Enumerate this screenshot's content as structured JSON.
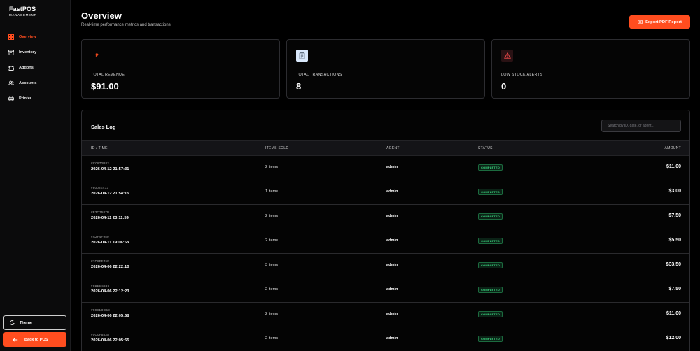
{
  "sidebar": {
    "brand_name": "FastPOS",
    "brand_sub": "MANAGEMENT",
    "items": [
      {
        "label": "Overview",
        "icon": "grid-icon",
        "active": true
      },
      {
        "label": "Inventory",
        "icon": "box-icon",
        "active": false
      },
      {
        "label": "Addons",
        "icon": "puzzle-icon",
        "active": false
      },
      {
        "label": "Accounts",
        "icon": "users-icon",
        "active": false
      },
      {
        "label": "Printer",
        "icon": "printer-icon",
        "active": false
      }
    ],
    "theme_label": "Theme",
    "back_label": "Back to POS"
  },
  "header": {
    "title": "Overview",
    "subtitle": "Real-time performance metrics and transactions.",
    "export_label": "Export PDF Report"
  },
  "stats": [
    {
      "icon_text": "₱",
      "label": "TOTAL REVENUE",
      "value": "$91.00"
    },
    {
      "label": "TOTAL TRANSACTIONS",
      "value": "8"
    },
    {
      "label": "LOW STOCK ALERTS",
      "value": "0"
    }
  ],
  "sales_log": {
    "title": "Sales Log",
    "search_placeholder": "Search by ID, date, or agent...",
    "columns": [
      "ID / TIME",
      "ITEMS SOLD",
      "AGENT",
      "STATUS",
      "AMOUNT"
    ],
    "rows": [
      {
        "id": "#C0870B82",
        "time": "2026-04-12 21:57:31",
        "items": "2 items",
        "agent": "admin",
        "status": "COMPLETED",
        "amount": "$11.00"
      },
      {
        "id": "#8008E413",
        "time": "2026-04-12 21:54:15",
        "items": "1 items",
        "agent": "admin",
        "status": "COMPLETED",
        "amount": "$3.00"
      },
      {
        "id": "#F3C7587B",
        "time": "2026-04-11 23:11:59",
        "items": "2 items",
        "agent": "admin",
        "status": "COMPLETED",
        "amount": "$7.50"
      },
      {
        "id": "#A2F4F950",
        "time": "2026-04-11 19:06:58",
        "items": "2 items",
        "agent": "admin",
        "status": "COMPLETED",
        "amount": "$5.50"
      },
      {
        "id": "#1D8FF45E",
        "time": "2026-04-06 22:22:10",
        "items": "3 items",
        "agent": "admin",
        "status": "COMPLETED",
        "amount": "$33.50"
      },
      {
        "id": "#8BEB4335",
        "time": "2026-04-06 22:12:23",
        "items": "2 items",
        "agent": "admin",
        "status": "COMPLETED",
        "amount": "$7.50"
      },
      {
        "id": "#90E1DD58",
        "time": "2026-04-06 22:05:58",
        "items": "2 items",
        "agent": "admin",
        "status": "COMPLETED",
        "amount": "$11.00"
      },
      {
        "id": "#0C0F583A",
        "time": "2026-04-06 22:05:55",
        "items": "2 items",
        "agent": "admin",
        "status": "COMPLETED",
        "amount": "$12.00"
      }
    ]
  },
  "colors": {
    "accent": "#ff4d1f",
    "status_completed": "#3ddc84",
    "background": "#000000"
  }
}
